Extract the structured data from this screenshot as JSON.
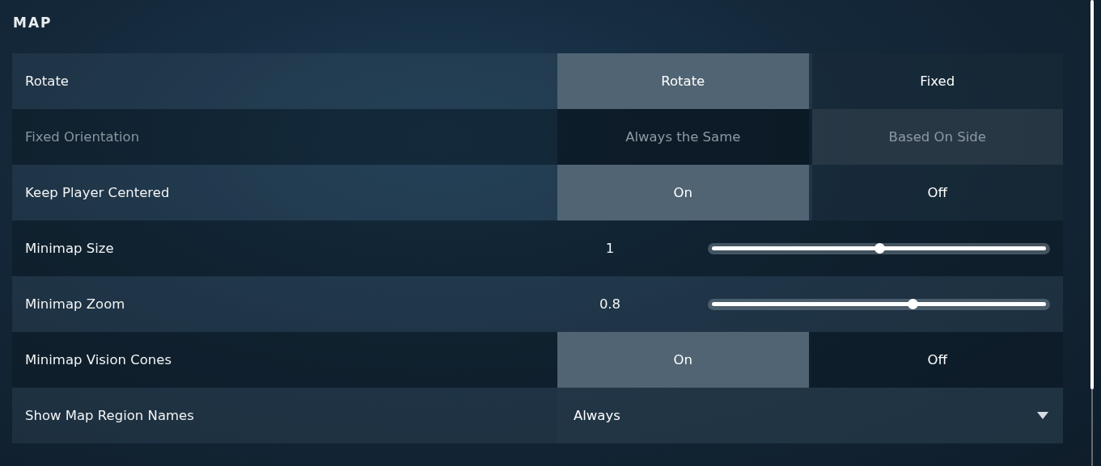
{
  "section": {
    "title": "MAP"
  },
  "settings": [
    {
      "kind": "toggle",
      "label": "Rotate",
      "disabled": false,
      "options": [
        {
          "label": "Rotate",
          "selected": true
        },
        {
          "label": "Fixed",
          "selected": false
        }
      ]
    },
    {
      "kind": "toggle",
      "label": "Fixed Orientation",
      "disabled": true,
      "options": [
        {
          "label": "Always the Same",
          "selected": false
        },
        {
          "label": "Based On Side",
          "selected": true
        }
      ]
    },
    {
      "kind": "toggle",
      "label": "Keep Player Centered",
      "disabled": false,
      "options": [
        {
          "label": "On",
          "selected": true
        },
        {
          "label": "Off",
          "selected": false
        }
      ]
    },
    {
      "kind": "slider",
      "label": "Minimap Size",
      "value": "1",
      "level": 0.5
    },
    {
      "kind": "slider",
      "label": "Minimap Zoom",
      "value": "0.8",
      "level": 0.6
    },
    {
      "kind": "toggle",
      "label": "Minimap Vision Cones",
      "disabled": false,
      "options": [
        {
          "label": "On",
          "selected": true
        },
        {
          "label": "Off",
          "selected": false
        }
      ]
    },
    {
      "kind": "dropdown",
      "label": "Show Map Region Names",
      "value": "Always"
    }
  ]
}
